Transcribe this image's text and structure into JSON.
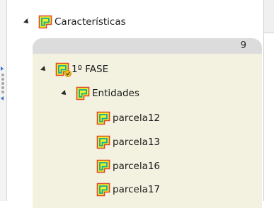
{
  "tree": {
    "root": {
      "label": "Características"
    },
    "group": {
      "count": "9"
    },
    "phase": {
      "label": "1º FASE"
    },
    "entities": {
      "label": "Entidades"
    },
    "parcels": [
      {
        "label": "parcela12"
      },
      {
        "label": "parcela13"
      },
      {
        "label": "parcela16"
      },
      {
        "label": "parcela17"
      }
    ]
  },
  "icons": {
    "feature_class": "polygon-layer-icon",
    "check_badge": "check-badge-icon"
  },
  "colors": {
    "icon_fill": "#e8f52a",
    "icon_border": "#e2462c",
    "icon_inner": "#16a89a",
    "badge": "#f2b619",
    "group_background": "#f3f2e1",
    "group_header": "#dcdcdc"
  }
}
